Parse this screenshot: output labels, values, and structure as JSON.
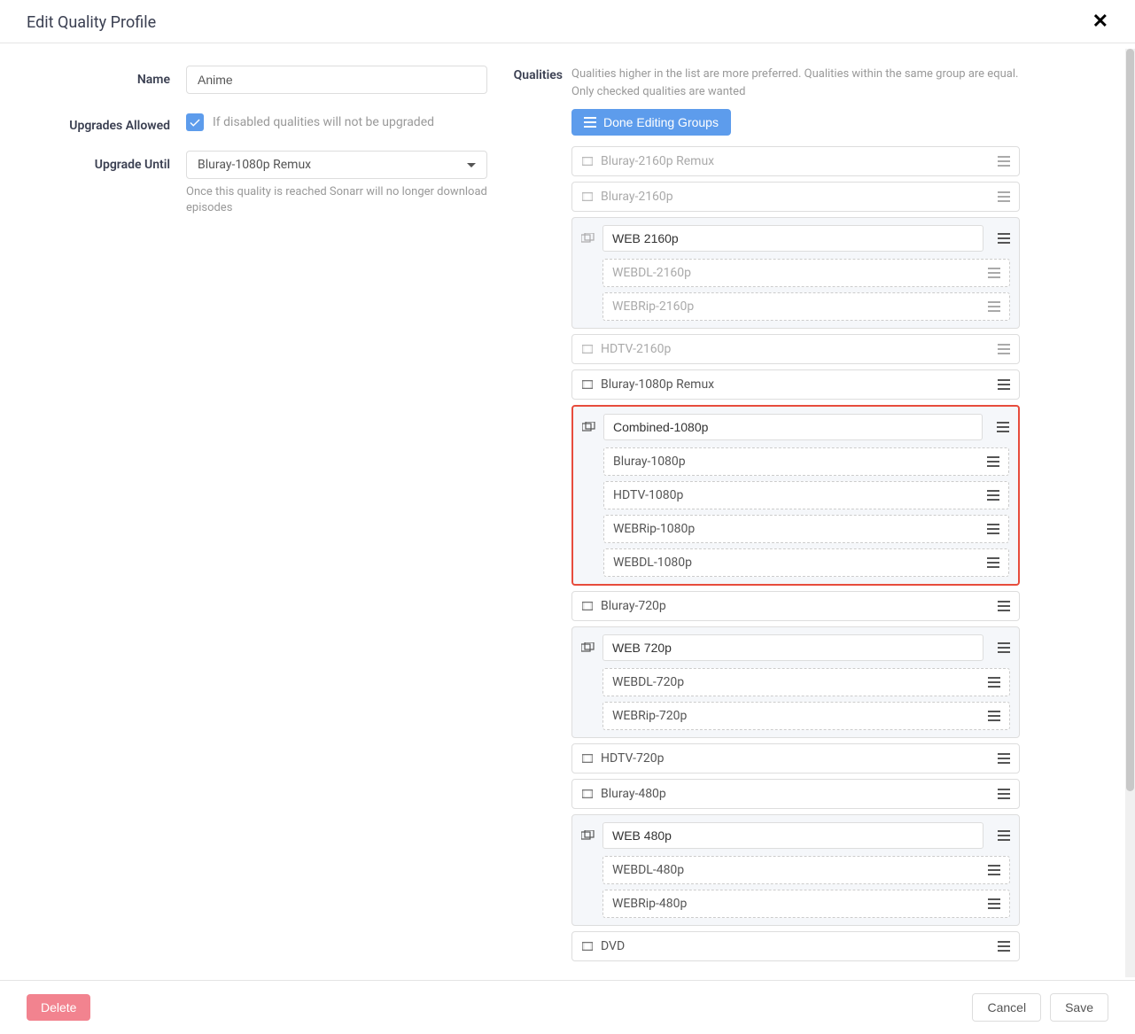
{
  "modal": {
    "title": "Edit Quality Profile",
    "close_label": "×"
  },
  "form": {
    "name_label": "Name",
    "name_value": "Anime",
    "upgrades_label": "Upgrades Allowed",
    "upgrades_hint": "If disabled qualities will not be upgraded",
    "upgrade_until_label": "Upgrade Until",
    "upgrade_until_value": "Bluray-1080p Remux",
    "upgrade_until_help": "Once this quality is reached Sonarr will no longer download episodes"
  },
  "qualities_section": {
    "label": "Qualities",
    "hint": "Qualities higher in the list are more preferred. Qualities within the same group are equal. Only checked qualities are wanted",
    "done_button": "Done Editing Groups"
  },
  "qualities": [
    {
      "type": "single",
      "label": "Bluray-2160p Remux",
      "disabled": true
    },
    {
      "type": "single",
      "label": "Bluray-2160p",
      "disabled": true
    },
    {
      "type": "group",
      "name": "WEB 2160p",
      "disabled": true,
      "items": [
        {
          "label": "WEBDL-2160p",
          "disabled": true
        },
        {
          "label": "WEBRip-2160p",
          "disabled": true
        }
      ]
    },
    {
      "type": "single",
      "label": "HDTV-2160p",
      "disabled": true
    },
    {
      "type": "single",
      "label": "Bluray-1080p Remux",
      "disabled": false
    },
    {
      "type": "group",
      "name": "Combined-1080p",
      "disabled": false,
      "highlight": true,
      "items": [
        {
          "label": "Bluray-1080p",
          "disabled": false
        },
        {
          "label": "HDTV-1080p",
          "disabled": false
        },
        {
          "label": "WEBRip-1080p",
          "disabled": false
        },
        {
          "label": "WEBDL-1080p",
          "disabled": false
        }
      ]
    },
    {
      "type": "single",
      "label": "Bluray-720p",
      "disabled": false
    },
    {
      "type": "group",
      "name": "WEB 720p",
      "disabled": false,
      "items": [
        {
          "label": "WEBDL-720p",
          "disabled": false
        },
        {
          "label": "WEBRip-720p",
          "disabled": false
        }
      ]
    },
    {
      "type": "single",
      "label": "HDTV-720p",
      "disabled": false
    },
    {
      "type": "single",
      "label": "Bluray-480p",
      "disabled": false
    },
    {
      "type": "group",
      "name": "WEB 480p",
      "disabled": false,
      "items": [
        {
          "label": "WEBDL-480p",
          "disabled": false
        },
        {
          "label": "WEBRip-480p",
          "disabled": false
        }
      ]
    },
    {
      "type": "single",
      "label": "DVD",
      "disabled": false
    }
  ],
  "footer": {
    "delete": "Delete",
    "cancel": "Cancel",
    "save": "Save"
  }
}
